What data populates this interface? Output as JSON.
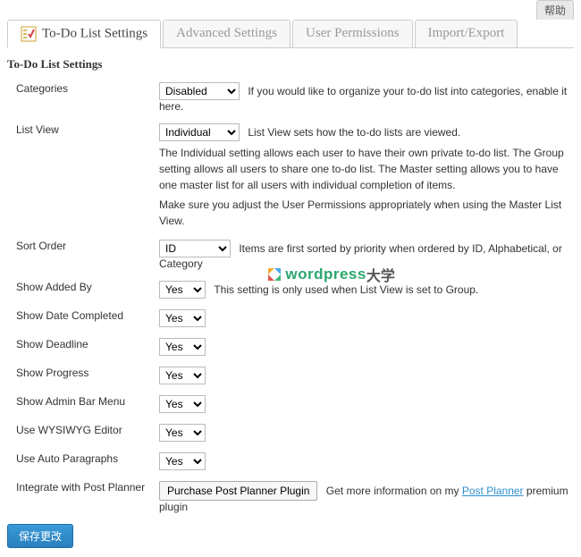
{
  "help_tab": "帮助",
  "tabs": {
    "todo": "To-Do List Settings",
    "advanced": "Advanced Settings",
    "permissions": "User Permissions",
    "import": "Import/Export"
  },
  "section_title": "To-Do List Settings",
  "rows": {
    "categories": {
      "label": "Categories",
      "value": "Disabled",
      "desc": "If you would like to organize your to-do list into categories, enable it here."
    },
    "list_view": {
      "label": "List View",
      "value": "Individual",
      "desc": "List View sets how the to-do lists are viewed.",
      "desc2": "The Individual setting allows each user to have their own private to-do list. The Group setting allows all users to share one to-do list. The Master setting allows you to have one master list for all users with individual completion of items.",
      "desc3": "Make sure you adjust the User Permissions appropriately when using the Master List View."
    },
    "sort_order": {
      "label": "Sort Order",
      "value": "ID",
      "desc": "Items are first sorted by priority when ordered by ID, Alphabetical, or Category"
    },
    "show_added_by": {
      "label": "Show Added By",
      "value": "Yes",
      "desc": "This setting is only used when List View is set to Group."
    },
    "show_date_completed": {
      "label": "Show Date Completed",
      "value": "Yes"
    },
    "show_deadline": {
      "label": "Show Deadline",
      "value": "Yes"
    },
    "show_progress": {
      "label": "Show Progress",
      "value": "Yes"
    },
    "show_admin_bar": {
      "label": "Show Admin Bar Menu",
      "value": "Yes"
    },
    "use_wysiwyg": {
      "label": "Use WYSIWYG Editor",
      "value": "Yes"
    },
    "use_auto_para": {
      "label": "Use Auto Paragraphs",
      "value": "Yes"
    },
    "integrate_post_planner": {
      "label": "Integrate with Post Planner",
      "button": "Purchase Post Planner Plugin",
      "desc_prefix": "Get more information on my ",
      "link_text": "Post Planner",
      "desc_suffix": " premium plugin"
    }
  },
  "save_button": "保存更改",
  "watermark": {
    "text": "wordpress",
    "cn": "大学"
  }
}
